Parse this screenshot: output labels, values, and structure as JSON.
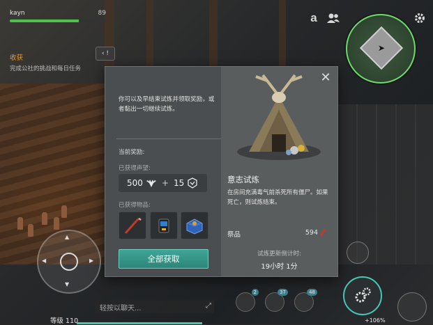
{
  "player": {
    "name": "kayn",
    "hp": "89",
    "hp_fraction": 0.72
  },
  "quest": {
    "title": "收获",
    "desc": "完成公社的挑战和每日任务",
    "expand_label": "‹ !"
  },
  "top_icons": [
    "a-icon",
    "friends-icon",
    "settings-icon"
  ],
  "top_icon_glyphs": {
    "a": "a"
  },
  "modal": {
    "intro": "你可以及早结束试炼并领取奖励，或者黏出一切继续试炼。",
    "current_reward_label": "当前奖励:",
    "reputation_label": "已获得声望:",
    "rep_value_1": "500",
    "plus": "+",
    "rep_value_2": "15",
    "items_label": "已获得物品:",
    "items": [
      "crowbar-icon",
      "pda-icon",
      "supply-box-icon"
    ],
    "claim_label": "全部获取",
    "close_label": "✕",
    "trial_title": "意志试炼",
    "trial_desc": "在房间充满毒气前杀死所有僵尸。如果死亡，则试炼结束。",
    "offering_label": "祭品",
    "offering_value": "594",
    "countdown_label": "试炼更新倒计时:",
    "countdown_value": "19小时 1分"
  },
  "hud": {
    "chat_placeholder": "轻按以聊天...",
    "level_label": "等级 110",
    "slot_badges": [
      "2",
      "37",
      "48"
    ],
    "percent": "+106%"
  },
  "colors": {
    "accent": "#45c7b4",
    "hp": "#4fc24a",
    "quest": "#e89a32",
    "offering": "#c0392b"
  }
}
